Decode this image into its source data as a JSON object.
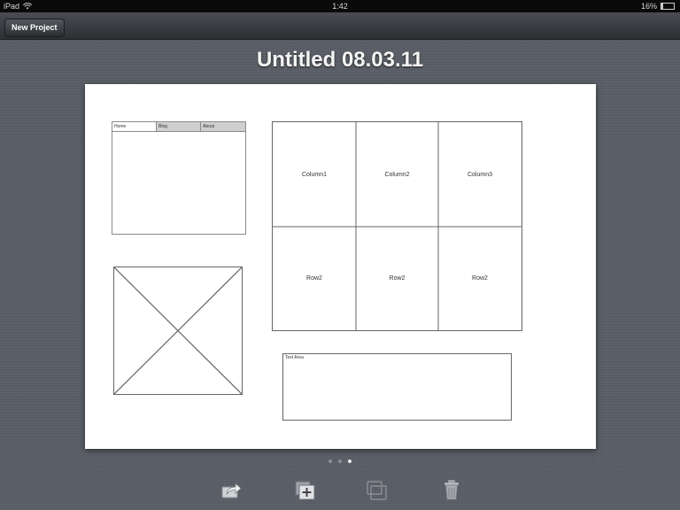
{
  "status_bar": {
    "device": "iPad",
    "time": "1:42",
    "battery": "16%",
    "battery_level": 0.16
  },
  "nav": {
    "new_project_label": "New Project"
  },
  "project": {
    "title": "Untitled 08.03.11"
  },
  "wireframe": {
    "tabs": [
      {
        "label": "Home",
        "active": true
      },
      {
        "label": "Blog",
        "active": false
      },
      {
        "label": "About",
        "active": false
      }
    ],
    "table": {
      "header_row": [
        "Column1",
        "Column2",
        "Column3"
      ],
      "body_row": [
        "Row2",
        "Row2",
        "Row2"
      ]
    },
    "textarea_label": "Text Area"
  },
  "pager": {
    "count": 3,
    "active_index": 2
  },
  "toolbar": {
    "icons": [
      "share-icon",
      "add-page-icon",
      "duplicate-icon",
      "trash-icon"
    ]
  },
  "colors": {
    "background": "#5a5e66",
    "canvas": "#ffffff",
    "wire_line": "#666666"
  }
}
